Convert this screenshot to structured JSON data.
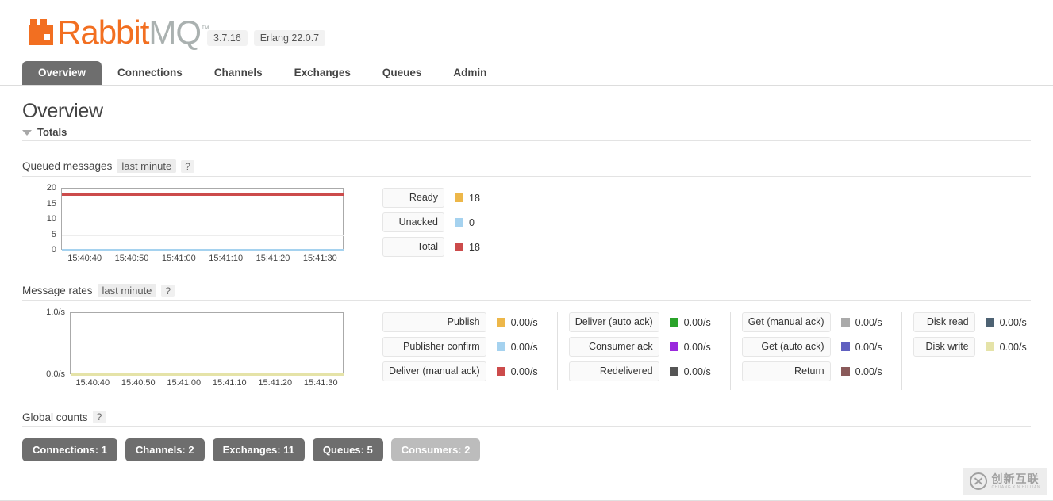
{
  "header": {
    "logo_text_1": "Rabbit",
    "logo_text_2": "MQ",
    "logo_tm": "™",
    "logo_icon": "rabbit-logo-icon",
    "version": "3.7.16",
    "erlang_version": "Erlang 22.0.7"
  },
  "tabs": [
    {
      "label": "Overview",
      "active": true
    },
    {
      "label": "Connections",
      "active": false
    },
    {
      "label": "Channels",
      "active": false
    },
    {
      "label": "Exchanges",
      "active": false
    },
    {
      "label": "Queues",
      "active": false
    },
    {
      "label": "Admin",
      "active": false
    }
  ],
  "page": {
    "title": "Overview",
    "totals_section_label": "Totals"
  },
  "queued_messages": {
    "label": "Queued messages",
    "period": "last minute",
    "help": "?",
    "legend": [
      {
        "label": "Ready",
        "value": "18",
        "color": "#edb749"
      },
      {
        "label": "Unacked",
        "value": "0",
        "color": "#a5d2ef"
      },
      {
        "label": "Total",
        "value": "18",
        "color": "#cc4b4b"
      }
    ]
  },
  "message_rates": {
    "label": "Message rates",
    "period": "last minute",
    "help": "?",
    "columns": [
      {
        "items": [
          {
            "label": "Publish",
            "value": "0.00/s",
            "color": "#edb749"
          },
          {
            "label": "Publisher confirm",
            "value": "0.00/s",
            "color": "#a5d2ef"
          },
          {
            "label": "Deliver (manual ack)",
            "value": "0.00/s",
            "color": "#cc4b4b"
          }
        ]
      },
      {
        "items": [
          {
            "label": "Deliver (auto ack)",
            "value": "0.00/s",
            "color": "#2aa32a"
          },
          {
            "label": "Consumer ack",
            "value": "0.00/s",
            "color": "#9a29dd"
          },
          {
            "label": "Redelivered",
            "value": "0.00/s",
            "color": "#555555"
          }
        ]
      },
      {
        "items": [
          {
            "label": "Get (manual ack)",
            "value": "0.00/s",
            "color": "#aaaaaa"
          },
          {
            "label": "Get (auto ack)",
            "value": "0.00/s",
            "color": "#6060c0"
          },
          {
            "label": "Return",
            "value": "0.00/s",
            "color": "#8a5a5a"
          }
        ]
      },
      {
        "items": [
          {
            "label": "Disk read",
            "value": "0.00/s",
            "color": "#4d6273"
          },
          {
            "label": "Disk write",
            "value": "0.00/s",
            "color": "#e5e3a8"
          }
        ]
      }
    ]
  },
  "global_counts": {
    "label": "Global counts",
    "help": "?",
    "badges": [
      {
        "label": "Connections: 1",
        "muted": false
      },
      {
        "label": "Channels: 2",
        "muted": false
      },
      {
        "label": "Exchanges: 11",
        "muted": false
      },
      {
        "label": "Queues: 5",
        "muted": false
      },
      {
        "label": "Consumers: 2",
        "muted": true
      }
    ]
  },
  "watermark": {
    "cn": "创新互联",
    "en": "CHUANG XIN HU LIAN",
    "icon": "circle-x-icon"
  },
  "chart_data": [
    {
      "type": "line",
      "title": "Queued messages",
      "xlabel": "",
      "ylabel": "",
      "ylim": [
        0,
        20
      ],
      "yticks": [
        0,
        5,
        10,
        15,
        20
      ],
      "ytick_labels": [
        "0",
        "5",
        "10",
        "15",
        "20"
      ],
      "x": [
        "15:40:40",
        "15:40:50",
        "15:41:00",
        "15:41:10",
        "15:41:20",
        "15:41:30"
      ],
      "xtick_labels": [
        "15:40:40",
        "15:40:50",
        "15:41:00",
        "15:41:10",
        "15:41:20",
        "15:41:30"
      ],
      "grid": true,
      "legend_position": "right",
      "series": [
        {
          "name": "Total",
          "color": "#cc4b4b",
          "values": [
            18,
            18,
            18,
            18,
            18,
            18
          ]
        },
        {
          "name": "Ready",
          "color": "#edb749",
          "values": [
            18,
            18,
            18,
            18,
            18,
            18
          ]
        },
        {
          "name": "Unacked",
          "color": "#a5d2ef",
          "values": [
            0,
            0,
            0,
            0,
            0,
            0
          ]
        }
      ]
    },
    {
      "type": "line",
      "title": "Message rates",
      "xlabel": "",
      "ylabel": "",
      "ylim": [
        0,
        1
      ],
      "yticks": [
        0,
        1
      ],
      "ytick_labels": [
        "0.0/s",
        "1.0/s"
      ],
      "x": [
        "15:40:40",
        "15:40:50",
        "15:41:00",
        "15:41:10",
        "15:41:20",
        "15:41:30"
      ],
      "xtick_labels": [
        "15:40:40",
        "15:40:50",
        "15:41:00",
        "15:41:10",
        "15:41:20",
        "15:41:30"
      ],
      "grid": false,
      "legend_position": "right",
      "series": [
        {
          "name": "Publish",
          "color": "#e5e3a8",
          "values": [
            0,
            0,
            0,
            0,
            0,
            0
          ]
        },
        {
          "name": "Disk write",
          "color": "#e5e3a8",
          "values": [
            0,
            0,
            0,
            0,
            0,
            0
          ]
        }
      ]
    }
  ]
}
